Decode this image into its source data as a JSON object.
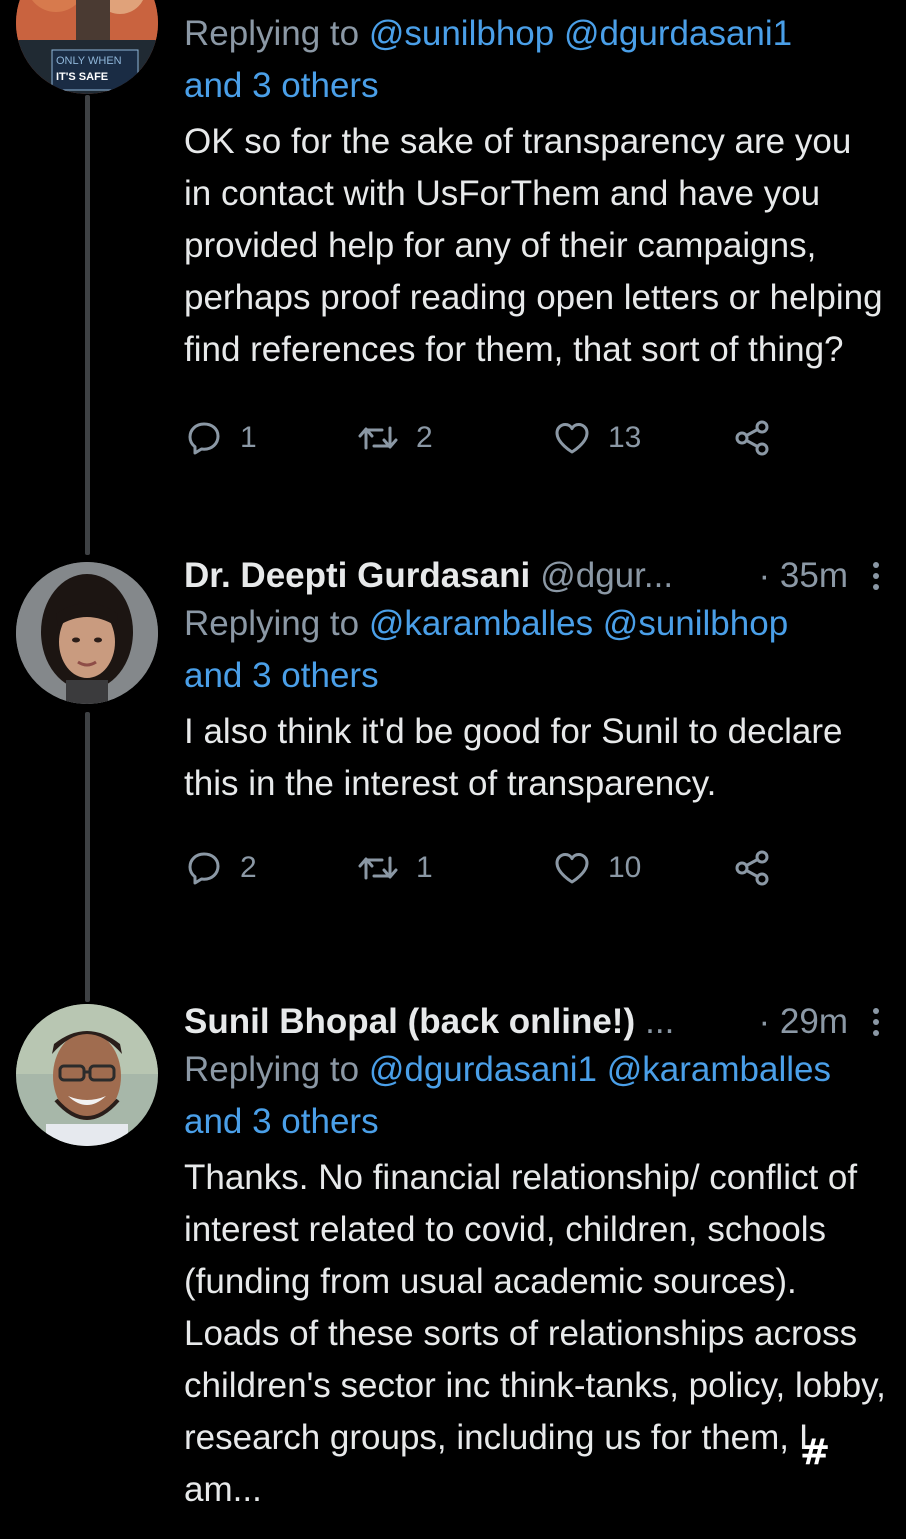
{
  "tweets": [
    {
      "reply_prefix": "Replying to",
      "mentions": "@sunilbhop @dgurdasani1",
      "others": "and 3 others",
      "text": "OK so for the sake of transparency are you in contact with UsForThem and have you provided help for any of their campaigns, perhaps proof reading open letters or helping find references for them, that sort of thing?",
      "avatar_caption_1": "ONLY WHEN",
      "avatar_caption_2": "IT'S SAFE",
      "replies": "1",
      "retweets": "2",
      "likes": "13"
    },
    {
      "name": "Dr. Deepti Gurdasani",
      "handle": "@dgur...",
      "time": "· 35m",
      "reply_prefix": "Replying to",
      "mentions": "@karamballes @sunilbhop",
      "others": "and 3 others",
      "text": "I also think it'd be good for Sunil to declare this in the interest of transparency.",
      "replies": "2",
      "retweets": "1",
      "likes": "10"
    },
    {
      "name": "Sunil Bhopal (back online!)",
      "handle": "...",
      "time": "· 29m",
      "reply_prefix": "Replying to",
      "mentions": "@dgurdasani1 @karamballes",
      "others": "and 3 others",
      "text": "Thanks. No financial relationship/ conflict of interest related to covid, children, schools (funding from usual academic sources). Loads of these sorts of relationships across children's sector inc think-tanks, policy, lobby, research groups, including us for them, I am..."
    }
  ],
  "overlay_mark": "#",
  "colors": {
    "background": "#000000",
    "text": "#e7e9ea",
    "muted": "#8b98a5",
    "link": "#4a9fe8",
    "thread_line": "#3e4144"
  }
}
